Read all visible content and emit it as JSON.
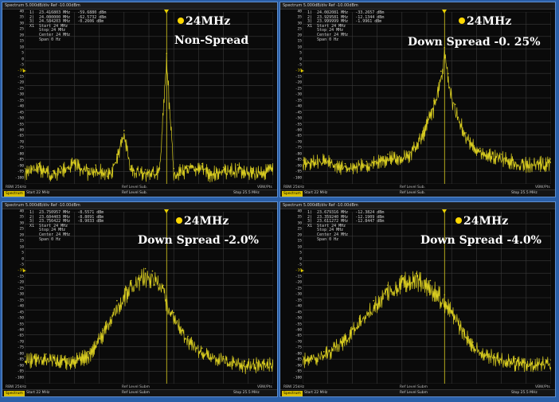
{
  "colors": {
    "trace": "#d8cc20",
    "grid": "#3a3a3a",
    "accent": "#ffd800",
    "frame": "#2a5fa8"
  },
  "panels": [
    {
      "header": "Spectrum 5.000dB/div  Ref -10.00dBm",
      "markers": "1)  23.416803 MHz   -59.6880 dBm\n2)  24.000000 MHz   -62.5732 dBm\n3)  24.584203 MHz   -0.2606 dBm\nX1  Start 24 MHz\n    Stop 24 MHz\n    Center 24 MHz\n    Span 0 Hz",
      "freq_label": "24MHz",
      "mode_label": "Non-Spread",
      "status_left": "RBW 25kHz",
      "status_center": "Ref Level Sub.",
      "status_right": "VBW/Pts",
      "footer_tag": "Spectrum",
      "footer_start": "Start 22 MHz",
      "footer_center": "Ref Level Sub.",
      "footer_stop": "Stop 25.5 MHz"
    },
    {
      "header": "Spectrum 5.000dB/div  Ref -10.00dBm",
      "markers": "1)  24.002081 MHz   -33.2657 dBm\n2)  23.929581 MHz   -12.1344 dBm\n3)  23.999999 MHz   -1.9961 dBm\nX1  Start 24 MHz\n    Stop 24 MHz\n    Center 24 MHz\n    Span 0 Hz",
      "freq_label": "24MHz",
      "mode_label": "Down Spread -0. 25%",
      "status_left": "RBW 25kHz",
      "status_center": "Ref Level Sub.",
      "status_right": "VBW/Pts",
      "footer_tag": "Spectrum",
      "footer_start": "Start 22 MHz",
      "footer_center": "Ref Level Sub.",
      "footer_stop": "Stop 25.5 MHz"
    },
    {
      "header": "Spectrum 5.000dB/div  Ref -10.00dBm",
      "markers": "1)  23.750957 MHz   -8.5571 dBm\n2)  23.604403 MHz   -8.8091 dBm\n3)  23.756422 MHz   -8.9033 dBm\nX1  Start 24 MHz\n    Stop 24 MHz\n    Center 24 MHz\n    Span 0 Hz",
      "freq_label": "24MHz",
      "mode_label": "Down Spread -2.0%",
      "status_left": "RBW 25kHz",
      "status_center": "Ref Level Subm",
      "status_right": "VBW/Pts",
      "footer_tag": "Spectrum",
      "footer_start": "Start 22 MHz",
      "footer_center": "Ref Level Subm",
      "footer_stop": "Stop 25.5 MHz"
    },
    {
      "header": "Spectrum 5.000dB/div  Ref -10.00dBm",
      "markers": "1)  23.679316 MHz   -12.3824 dBm\n2)  23.359240 MHz   -12.1909 dBm\n3)  23.611272 MHz   -12.8447 dBm\nX1  Start 24 MHz\n    Stop 24 MHz\n    Center 24 MHz\n    Span 0 Hz",
      "freq_label": "24MHz",
      "mode_label": "Down Spread -4.0%",
      "status_left": "RBW 25kHz",
      "status_center": "Ref Level Subm",
      "status_right": "VBW/Pts",
      "footer_tag": "Spectrum",
      "footer_start": "Start 22 MHz",
      "footer_center": "Ref Level Subm",
      "footer_stop": "Stop 25.5 MHz"
    }
  ],
  "chart_data": [
    {
      "type": "line",
      "title": "Non-Spread",
      "xlim": [
        22,
        25.5
      ],
      "ylim": [
        -105,
        40
      ],
      "yticks": [
        40,
        35,
        30,
        25,
        20,
        15,
        10,
        5,
        0,
        -5,
        -10,
        -15,
        -20,
        -25,
        -30,
        -35,
        -40,
        -45,
        -50,
        -55,
        -60,
        -65,
        -70,
        -75,
        -80,
        -85,
        -90,
        -95,
        -100
      ],
      "ref_level": -10,
      "x": [
        22.0,
        22.2,
        22.4,
        22.5,
        22.7,
        22.9,
        23.0,
        23.2,
        23.3,
        23.4,
        23.5,
        23.7,
        23.9,
        24.0,
        24.1,
        24.3,
        24.5,
        24.6,
        24.8,
        25.0,
        25.2,
        25.5
      ],
      "series": [
        {
          "values": [
            -92,
            -88,
            -94,
            -90,
            -85,
            -92,
            -89,
            -94,
            -80,
            -60,
            -90,
            -93,
            -92,
            5,
            -92,
            -90,
            -88,
            -93,
            -91,
            -89,
            -92,
            -90
          ]
        }
      ]
    },
    {
      "type": "line",
      "title": "Down Spread -0. 25%",
      "xlim": [
        22,
        25.5
      ],
      "ylim": [
        -105,
        40
      ],
      "yticks": [
        40,
        35,
        30,
        25,
        20,
        15,
        10,
        5,
        0,
        -5,
        -10,
        -15,
        -20,
        -25,
        -30,
        -35,
        -40,
        -45,
        -50,
        -55,
        -60,
        -65,
        -70,
        -75,
        -80,
        -85,
        -90,
        -95,
        -100
      ],
      "ref_level": -10,
      "x": [
        22.0,
        22.3,
        22.6,
        22.9,
        23.2,
        23.5,
        23.7,
        23.85,
        23.95,
        24.0,
        24.05,
        24.15,
        24.3,
        24.5,
        24.8,
        25.1,
        25.5
      ],
      "series": [
        {
          "values": [
            -85,
            -82,
            -88,
            -86,
            -80,
            -78,
            -60,
            -35,
            -10,
            10,
            -12,
            -38,
            -62,
            -75,
            -80,
            -85,
            -84
          ]
        }
      ]
    },
    {
      "type": "line",
      "title": "Down Spread -2.0%",
      "xlim": [
        22,
        25.5
      ],
      "ylim": [
        -105,
        40
      ],
      "yticks": [
        40,
        35,
        30,
        25,
        20,
        15,
        10,
        5,
        0,
        -5,
        -10,
        -15,
        -20,
        -25,
        -30,
        -35,
        -40,
        -45,
        -50,
        -55,
        -60,
        -65,
        -70,
        -75,
        -80,
        -85,
        -90,
        -95,
        -100
      ],
      "ref_level": -10,
      "x": [
        22.0,
        22.3,
        22.6,
        22.9,
        23.1,
        23.3,
        23.5,
        23.7,
        23.8,
        23.95,
        24.1,
        24.3,
        24.5,
        24.8,
        25.1,
        25.5
      ],
      "series": [
        {
          "values": [
            -82,
            -80,
            -84,
            -78,
            -60,
            -35,
            -18,
            -8,
            -10,
            -22,
            -45,
            -65,
            -75,
            -82,
            -86,
            -85
          ]
        }
      ]
    },
    {
      "type": "line",
      "title": "Down Spread -4.0%",
      "xlim": [
        22,
        25.5
      ],
      "ylim": [
        -105,
        40
      ],
      "yticks": [
        40,
        35,
        30,
        25,
        20,
        15,
        10,
        5,
        0,
        -5,
        -10,
        -15,
        -20,
        -25,
        -30,
        -35,
        -40,
        -45,
        -50,
        -55,
        -60,
        -65,
        -70,
        -75,
        -80,
        -85,
        -90,
        -95,
        -100
      ],
      "ref_level": -10,
      "x": [
        22.0,
        22.3,
        22.6,
        22.8,
        23.0,
        23.2,
        23.4,
        23.6,
        23.8,
        24.0,
        24.2,
        24.4,
        24.7,
        25.0,
        25.5
      ],
      "series": [
        {
          "values": [
            -82,
            -78,
            -65,
            -50,
            -35,
            -22,
            -14,
            -12,
            -18,
            -30,
            -52,
            -70,
            -80,
            -84,
            -85
          ]
        }
      ]
    }
  ]
}
